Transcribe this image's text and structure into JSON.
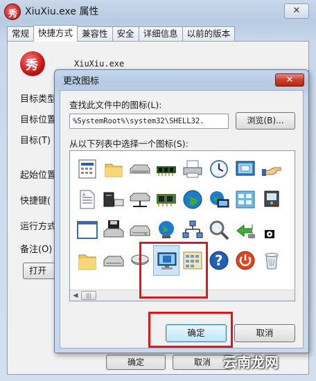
{
  "outer_window": {
    "title": "XiuXiu.exe 属性",
    "close_glyph": "✕",
    "tabs": [
      "常规",
      "快捷方式",
      "兼容性",
      "安全",
      "详细信息",
      "以前的版本"
    ],
    "active_tab": "快捷方式",
    "app_name": "XiuXiu.exe",
    "app_icon_glyph": "秀",
    "field_labels": [
      "目标类型",
      "目标位置",
      "目标(T)",
      "起始位置",
      "快捷键(",
      "运行方式",
      "备注(O)"
    ],
    "open_button": "打开",
    "bottom_buttons": [
      "确定",
      "取消"
    ]
  },
  "dialog": {
    "title": "更改图标",
    "close_glyph": "✕",
    "find_label": "查找此文件中的图标(L):",
    "path_value": "%SystemRoot%\\system32\\SHELL32.",
    "browse_button": "浏览(B)...",
    "list_label": "从以下列表中选择一个图标(S):",
    "icons": [
      "document-window-icon",
      "folder-icon",
      "drive-icon",
      "memory-chip-icon",
      "printer-icon",
      "clock-icon",
      "display-settings-icon",
      "hand-pointer-icon",
      "text-document-icon",
      "computer-icon",
      "network-drive-icon",
      "network-icon",
      "globe-icon",
      "computer-globe-icon",
      "control-panel-icon",
      "device-icon",
      "blank-window-icon",
      "floppy-drive-icon",
      "disk-drive-icon",
      "globe-network-icon",
      "network-tree-icon",
      "magnifier-icon",
      "green-arrow-icon",
      "dvd-icon",
      "folder-open-icon",
      "cd-drive-icon",
      "hard-disk-icon",
      "monitor-icon",
      "panel-grid-icon",
      "help-icon",
      "power-icon",
      "recycle-bin-icon"
    ],
    "selected_icon": "monitor-icon",
    "ok_button": "确定",
    "cancel_button": "取消",
    "scroll_thumb_glyph": "|||"
  },
  "colors": {
    "annotation_red": "#e0161e",
    "selection": "#cde3f8"
  },
  "watermark": "云南龙网"
}
